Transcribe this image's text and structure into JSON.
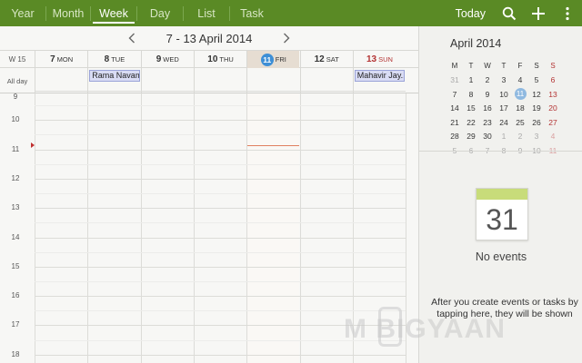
{
  "toolbar": {
    "tabs": [
      {
        "label": "Year",
        "active": false
      },
      {
        "label": "Month",
        "active": false
      },
      {
        "label": "Week",
        "active": true
      },
      {
        "label": "Day",
        "active": false
      },
      {
        "label": "List",
        "active": false
      },
      {
        "label": "Task",
        "active": false
      }
    ],
    "today_label": "Today",
    "icons": [
      "search-icon",
      "add-icon",
      "more-icon"
    ],
    "accent_color": "#5a8a25"
  },
  "week": {
    "range_label": "7 - 13 April 2014",
    "week_label": "W 15",
    "allday_label": "All day",
    "days": [
      {
        "num": "7",
        "name": "MON",
        "today": false,
        "sunday": false
      },
      {
        "num": "8",
        "name": "TUE",
        "today": false,
        "sunday": false
      },
      {
        "num": "9",
        "name": "WED",
        "today": false,
        "sunday": false
      },
      {
        "num": "10",
        "name": "THU",
        "today": false,
        "sunday": false
      },
      {
        "num": "11",
        "name": "FRI",
        "today": true,
        "sunday": false
      },
      {
        "num": "12",
        "name": "SAT",
        "today": false,
        "sunday": false
      },
      {
        "num": "13",
        "name": "SUN",
        "today": false,
        "sunday": true
      }
    ],
    "allday_events": [
      {
        "day_index": 1,
        "title": "Rama Navami"
      },
      {
        "day_index": 6,
        "title": "Mahavir Jay..."
      }
    ],
    "hours": [
      "9",
      "10",
      "11",
      "12",
      "13",
      "14",
      "15",
      "16",
      "17",
      "18"
    ]
  },
  "mini_calendar": {
    "title": "April 2014",
    "dow": [
      "M",
      "T",
      "W",
      "T",
      "F",
      "S",
      "S"
    ],
    "weeks": [
      [
        {
          "d": "31",
          "o": true
        },
        {
          "d": "1"
        },
        {
          "d": "2"
        },
        {
          "d": "3"
        },
        {
          "d": "4"
        },
        {
          "d": "5"
        },
        {
          "d": "6"
        }
      ],
      [
        {
          "d": "7"
        },
        {
          "d": "8"
        },
        {
          "d": "9"
        },
        {
          "d": "10"
        },
        {
          "d": "11",
          "t": true
        },
        {
          "d": "12"
        },
        {
          "d": "13"
        }
      ],
      [
        {
          "d": "14"
        },
        {
          "d": "15"
        },
        {
          "d": "16"
        },
        {
          "d": "17"
        },
        {
          "d": "18"
        },
        {
          "d": "19"
        },
        {
          "d": "20"
        }
      ],
      [
        {
          "d": "21"
        },
        {
          "d": "22"
        },
        {
          "d": "23"
        },
        {
          "d": "24"
        },
        {
          "d": "25"
        },
        {
          "d": "26"
        },
        {
          "d": "27"
        }
      ],
      [
        {
          "d": "28"
        },
        {
          "d": "29"
        },
        {
          "d": "30"
        },
        {
          "d": "1",
          "o": true
        },
        {
          "d": "2",
          "o": true
        },
        {
          "d": "3",
          "o": true
        },
        {
          "d": "4",
          "o": true
        }
      ],
      [
        {
          "d": "5",
          "o": true
        },
        {
          "d": "6",
          "o": true
        },
        {
          "d": "7",
          "o": true
        },
        {
          "d": "8",
          "o": true
        },
        {
          "d": "9",
          "o": true
        },
        {
          "d": "10",
          "o": true
        },
        {
          "d": "11",
          "o": true
        }
      ]
    ]
  },
  "events_panel": {
    "icon_day": "31",
    "no_events_label": "No events",
    "hint": "After you create events or tasks by tapping here, they will be shown"
  },
  "watermark": "M  BIGYAAN"
}
